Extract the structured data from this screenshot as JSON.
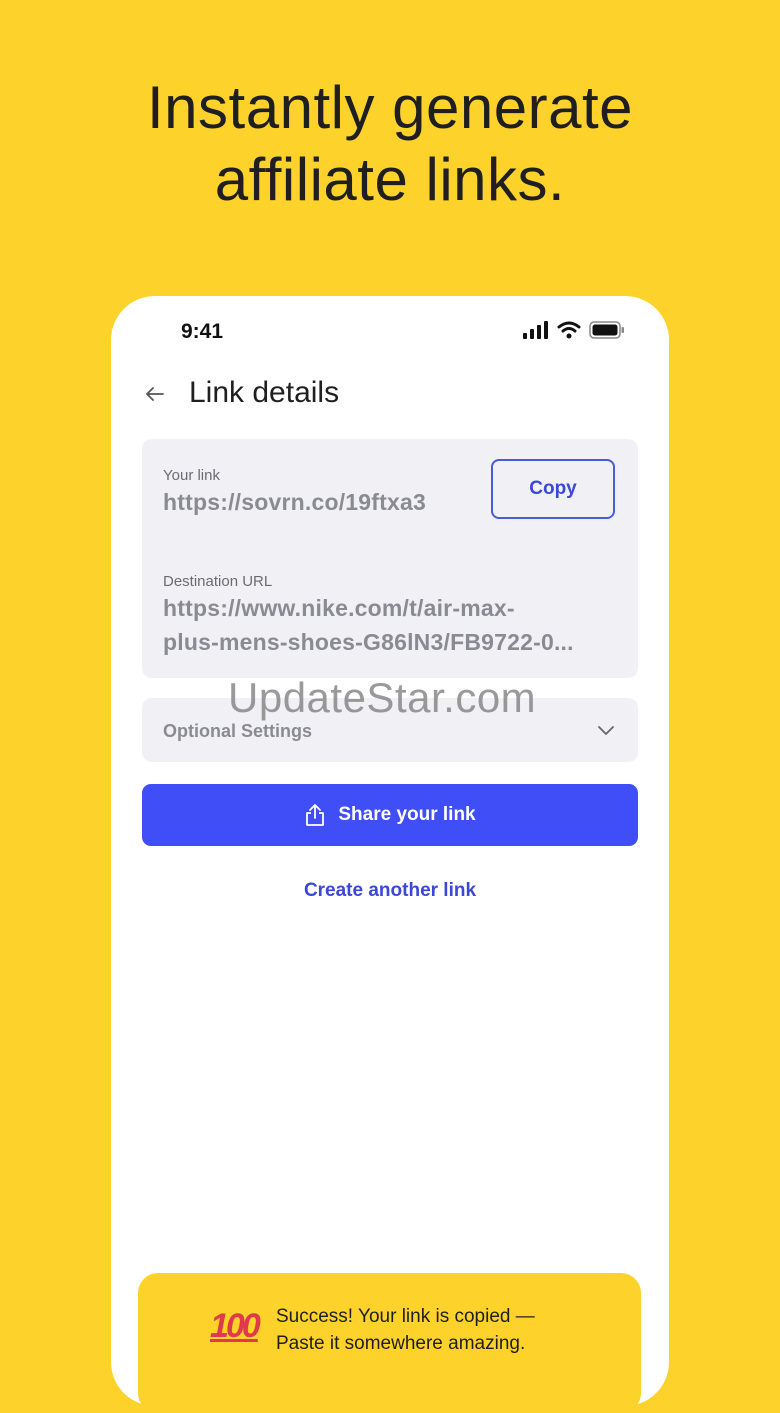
{
  "headline": {
    "line1": "Instantly generate",
    "line2": "affiliate links."
  },
  "status_bar": {
    "time": "9:41",
    "icons": [
      "signal-icon",
      "wifi-icon",
      "battery-icon"
    ]
  },
  "nav": {
    "title": "Link details",
    "back_icon": "back-arrow-icon"
  },
  "link_card": {
    "your_link_label": "Your link",
    "your_link_value": "https://sovrn.co/19ftxa3",
    "copy_label": "Copy",
    "destination_label": "Destination URL",
    "destination_line1": "https://www.nike.com/t/air-max-",
    "destination_line2": "plus-mens-shoes-G86lN3/FB9722-0..."
  },
  "optional_settings": {
    "label": "Optional Settings",
    "icon": "chevron-down-icon"
  },
  "share": {
    "label": "Share your link",
    "icon": "share-icon"
  },
  "create_another": "Create another link",
  "watermark": "UpdateStar.com",
  "toast": {
    "emoji": "100",
    "line1": "Success! Your link is copied —",
    "line2": "Paste it somewhere amazing."
  },
  "colors": {
    "background": "#FDD22A",
    "accent": "#3F4EF7",
    "card": "#F1F1F5"
  }
}
